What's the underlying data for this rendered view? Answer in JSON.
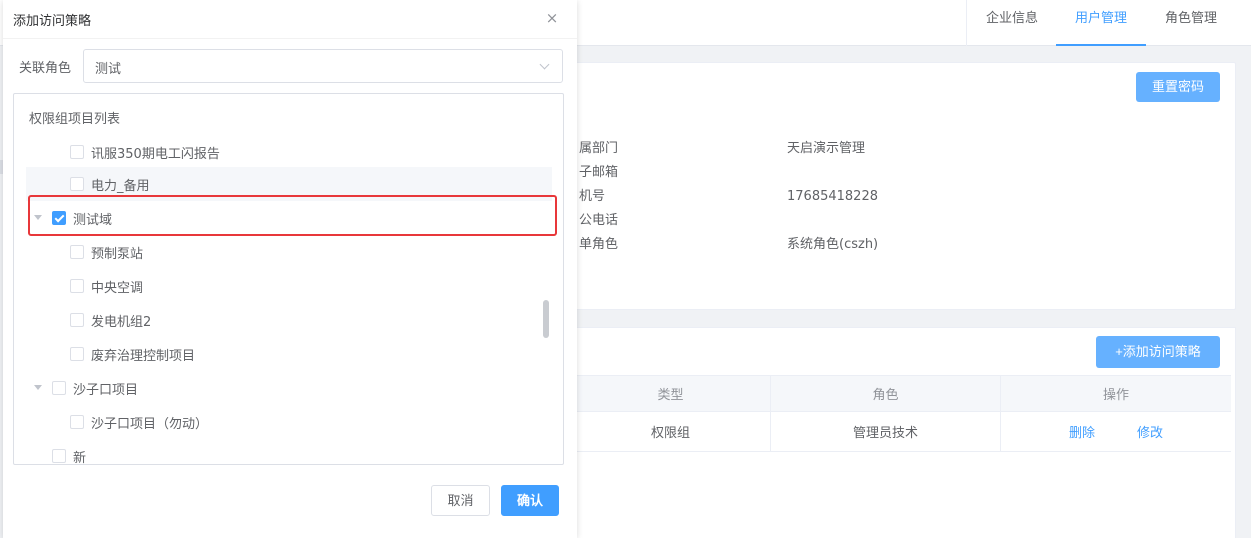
{
  "tabs": [
    {
      "label": "企业信息",
      "active": false
    },
    {
      "label": "用户管理",
      "active": true
    },
    {
      "label": "角色管理",
      "active": false
    }
  ],
  "info": {
    "reset_label": "重置密码",
    "rows": [
      {
        "label": "属部门",
        "value": "天启演示管理"
      },
      {
        "label": "子邮箱",
        "value": ""
      },
      {
        "label": "机号",
        "value": "17685418228"
      },
      {
        "label": "公电话",
        "value": ""
      },
      {
        "label": "单角色",
        "value": "系统角色(cszh)"
      }
    ]
  },
  "policy": {
    "add_label": "+添加访问策略",
    "headers": {
      "type": "类型",
      "role": "角色",
      "op": "操作"
    },
    "rows": [
      {
        "type": "权限组",
        "role": "管理员技术",
        "delete": "删除",
        "edit": "修改"
      }
    ]
  },
  "dialog": {
    "title": "添加访问策略",
    "close_glyph": "×",
    "role_label": "关联角色",
    "role_value": "测试",
    "tree_title": "权限组项目列表",
    "nodes": [
      {
        "label": "讯服350期电工闪报告",
        "level": 1,
        "checked": false,
        "expanded": false
      },
      {
        "label": "电力_备用",
        "level": 1,
        "checked": false,
        "expanded": false
      },
      {
        "label": "测试域",
        "level": 0,
        "checked": true,
        "expanded": true
      },
      {
        "label": "预制泵站",
        "level": 1,
        "checked": false,
        "expanded": false
      },
      {
        "label": "中央空调",
        "level": 1,
        "checked": false,
        "expanded": false
      },
      {
        "label": "发电机组2",
        "level": 1,
        "checked": false,
        "expanded": false
      },
      {
        "label": "废弃治理控制项目",
        "level": 1,
        "checked": false,
        "expanded": false
      },
      {
        "label": "沙子口项目",
        "level": 0,
        "checked": false,
        "expanded": true
      },
      {
        "label": "沙子口项目（勿动）",
        "level": 1,
        "checked": false,
        "expanded": false
      },
      {
        "label": "新",
        "level": 0,
        "checked": false,
        "expanded": false
      }
    ],
    "cancel_label": "取消",
    "confirm_label": "确认"
  },
  "colors": {
    "primary": "#409eff",
    "highlight": "#e8373a"
  }
}
